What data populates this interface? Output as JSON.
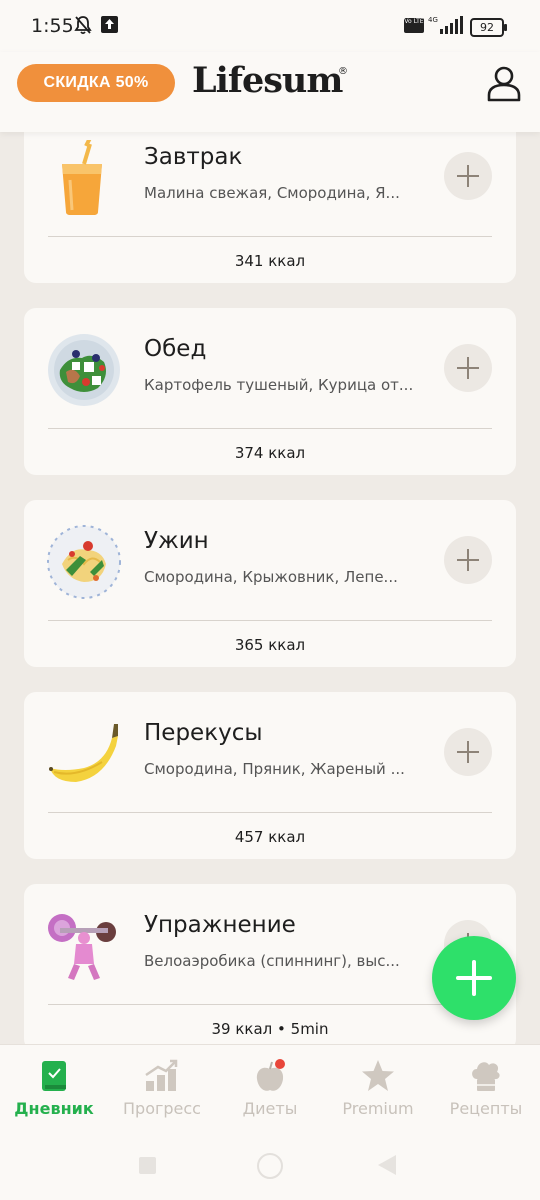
{
  "status_bar": {
    "time": "1:55",
    "volte": "Vo LTE",
    "network": "4G",
    "battery": "92"
  },
  "header": {
    "discount_label": "СКИДКА 50%",
    "logo": "Lifesum",
    "logo_mark": "®"
  },
  "meals": [
    {
      "title": "Завтрак",
      "items": "Малина свежая, Смородина, Я...",
      "kcal": "341 ккал"
    },
    {
      "title": "Обед",
      "items": "Картофель тушеный, Курица от...",
      "kcal": "374 ккал"
    },
    {
      "title": "Ужин",
      "items": "Смородина, Крыжовник, Лепе...",
      "kcal": "365 ккал"
    },
    {
      "title": "Перекусы",
      "items": "Смородина, Пряник, Жареный ...",
      "kcal": "457 ккал"
    },
    {
      "title": "Упражнение",
      "items": "Велоаэробика (спиннинг), выс...",
      "kcal": "39 ккал • 5min"
    }
  ],
  "bottom_nav": [
    {
      "label": "Дневник",
      "icon": "diary-book-icon",
      "active": true
    },
    {
      "label": "Прогресс",
      "icon": "progress-chart-icon",
      "active": false
    },
    {
      "label": "Диеты",
      "icon": "apple-icon",
      "active": false
    },
    {
      "label": "Premium",
      "icon": "star-icon",
      "active": false
    },
    {
      "label": "Рецепты",
      "icon": "chef-hat-icon",
      "active": false
    }
  ],
  "colors": {
    "accent_green": "#24b04d",
    "fab_green": "#2ee06a",
    "discount_orange": "#f0903c",
    "background": "#efebe6",
    "card": "#fbf9f6",
    "notification_red": "#e8463a"
  }
}
